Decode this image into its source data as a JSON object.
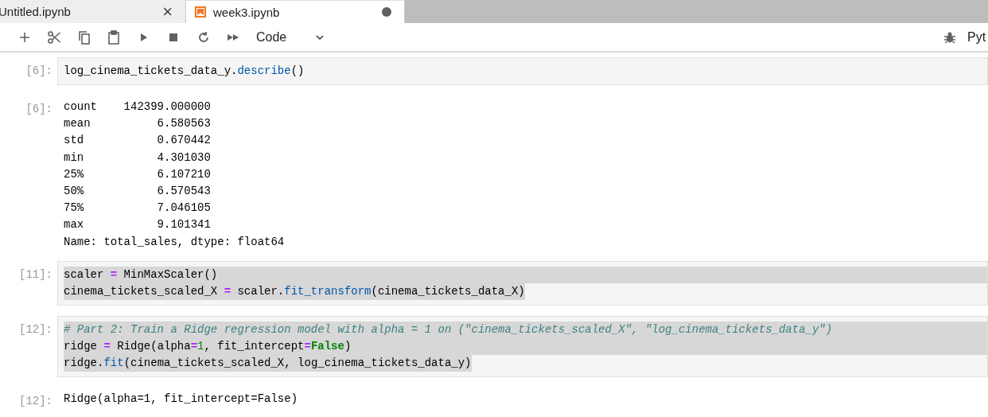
{
  "tabs": [
    {
      "label": "Untitled.ipynb",
      "selected": false,
      "close": "×",
      "unsaved": false
    },
    {
      "label": "week3.ipynb",
      "selected": true,
      "unsaved": true
    }
  ],
  "toolbar": {
    "buttons": [
      {
        "kind": "add"
      },
      {
        "kind": "cut"
      },
      {
        "kind": "copy"
      },
      {
        "kind": "paste"
      },
      {
        "kind": "run"
      },
      {
        "kind": "stop"
      },
      {
        "kind": "restart"
      },
      {
        "kind": "run-all"
      }
    ],
    "cell_type": "Code",
    "kernel": "Pyt"
  },
  "cells": [
    {
      "kind": "code",
      "prompt": "[6]:",
      "selected": false,
      "lines": [
        [
          {
            "kind": "plain",
            "t": "log_cinema_tickets_data_y."
          },
          {
            "kind": "func",
            "t": "describe"
          },
          {
            "kind": "plain",
            "t": "()"
          }
        ]
      ]
    },
    {
      "kind": "output",
      "prompt": "[6]:",
      "lines": [
        "count    142399.000000",
        "mean          6.580563",
        "std           0.670442",
        "min           4.301030",
        "25%           6.107210",
        "50%           6.570543",
        "75%           7.046105",
        "max           9.101341",
        "Name: total_sales, dtype: float64"
      ]
    },
    {
      "kind": "code",
      "prompt": "[11]:",
      "selected": true,
      "lines": [
        [
          {
            "kind": "plain",
            "t": "scaler "
          },
          {
            "kind": "op",
            "t": "="
          },
          {
            "kind": "plain",
            "t": " MinMaxScaler()"
          }
        ],
        [
          {
            "kind": "plain",
            "t": "cinema_tickets_scaled_X "
          },
          {
            "kind": "op",
            "t": "="
          },
          {
            "kind": "plain",
            "t": " scaler."
          },
          {
            "kind": "func",
            "t": "fit_transform"
          },
          {
            "kind": "plain",
            "t": "(cinema_tickets_data_X)"
          }
        ]
      ]
    },
    {
      "kind": "code",
      "prompt": "[12]:",
      "selected": true,
      "lines": [
        [
          {
            "kind": "comment",
            "t": "# Part 2: Train a Ridge regression model with alpha = 1 on (\"cinema_tickets_scaled_X\", \"log_cinema_tickets_data_y\")"
          }
        ],
        [
          {
            "kind": "plain",
            "t": "ridge "
          },
          {
            "kind": "op",
            "t": "="
          },
          {
            "kind": "plain",
            "t": " Ridge(alpha"
          },
          {
            "kind": "op",
            "t": "="
          },
          {
            "kind": "num",
            "t": "1"
          },
          {
            "kind": "plain",
            "t": ", fit_intercept"
          },
          {
            "kind": "op",
            "t": "="
          },
          {
            "kind": "kw",
            "t": "False"
          },
          {
            "kind": "plain",
            "t": ")"
          }
        ],
        [
          {
            "kind": "plain",
            "t": "ridge."
          },
          {
            "kind": "func",
            "t": "fit"
          },
          {
            "kind": "plain",
            "t": "(cinema_tickets_scaled_X, log_cinema_tickets_data_y)"
          }
        ]
      ]
    },
    {
      "kind": "output",
      "prompt": "[12]:",
      "lines": [
        "Ridge(alpha=1, fit_intercept=False)"
      ]
    }
  ]
}
